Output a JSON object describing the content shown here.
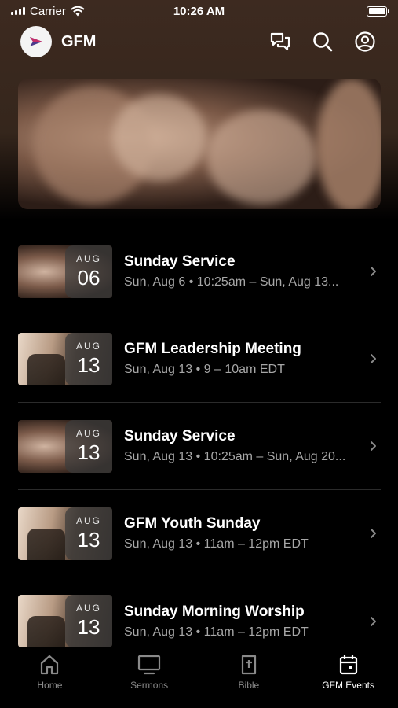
{
  "status": {
    "carrier": "Carrier",
    "time": "10:26 AM",
    "battery_level": 1.0
  },
  "header": {
    "title": "GFM"
  },
  "events": [
    {
      "thumb": "hands",
      "month": "AUG",
      "day": "06",
      "title": "Sunday Service",
      "subtitle": "Sun, Aug 6 • 10:25am – Sun, Aug 13..."
    },
    {
      "thumb": "sunset",
      "month": "AUG",
      "day": "13",
      "title": "GFM Leadership Meeting",
      "subtitle": "Sun, Aug 13 • 9 – 10am EDT"
    },
    {
      "thumb": "hands",
      "month": "AUG",
      "day": "13",
      "title": "Sunday Service",
      "subtitle": "Sun, Aug 13 • 10:25am – Sun, Aug 20..."
    },
    {
      "thumb": "sunset",
      "month": "AUG",
      "day": "13",
      "title": "GFM Youth Sunday",
      "subtitle": "Sun, Aug 13 • 11am – 12pm EDT"
    },
    {
      "thumb": "sunset",
      "month": "AUG",
      "day": "13",
      "title": "Sunday Morning Worship",
      "subtitle": "Sun, Aug 13 • 11am – 12pm EDT"
    }
  ],
  "tabs": [
    {
      "label": "Home",
      "icon": "home-icon",
      "active": false
    },
    {
      "label": "Sermons",
      "icon": "tv-icon",
      "active": false
    },
    {
      "label": "Bible",
      "icon": "bible-icon",
      "active": false
    },
    {
      "label": "GFM Events",
      "icon": "calendar-icon",
      "active": true
    }
  ],
  "colors": {
    "background": "#000000",
    "header_bg": "#3d2a20",
    "subtitle": "#a7a7a7",
    "tab_inactive": "#8a8a8a"
  }
}
